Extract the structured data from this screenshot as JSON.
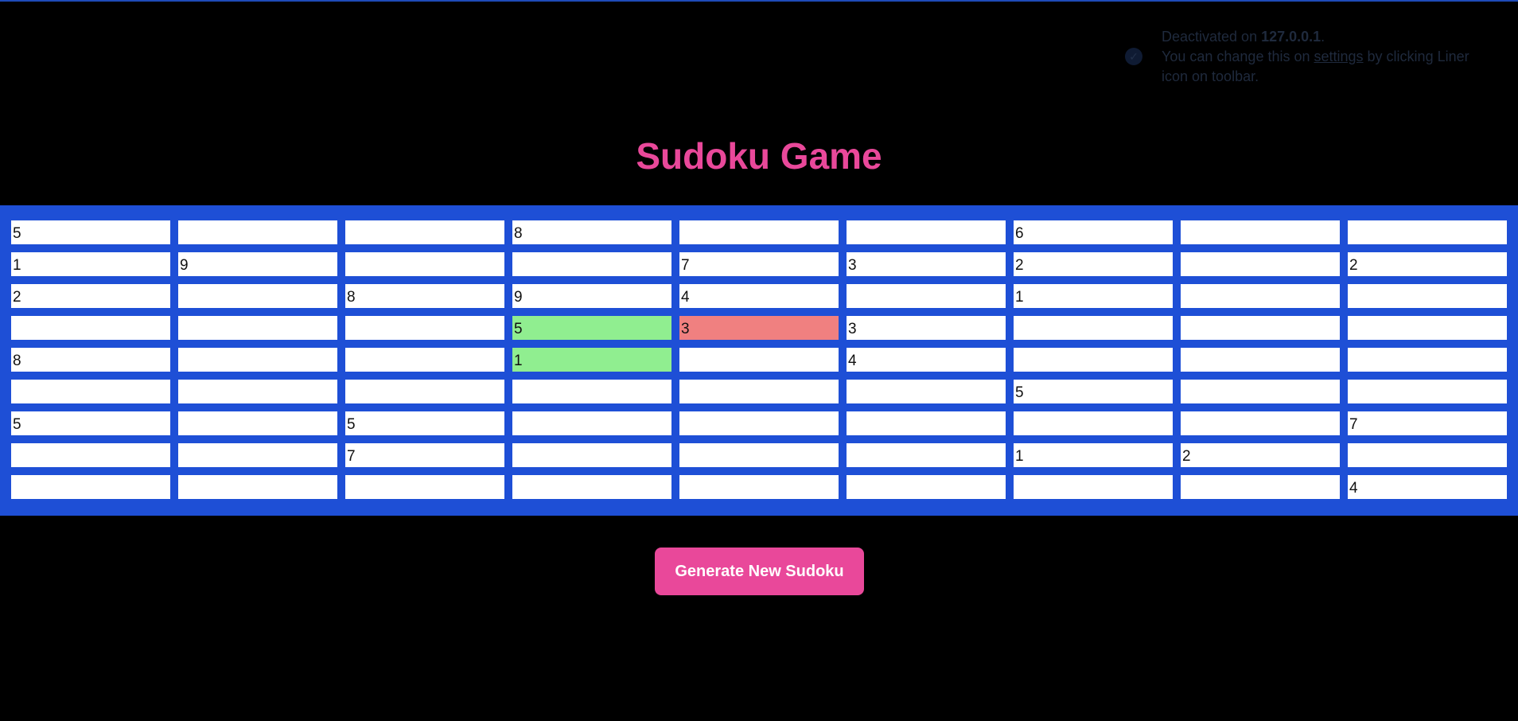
{
  "notice": {
    "line1_prefix": "Deactivated on ",
    "host": "127.0.0.1",
    "line1_suffix": ".",
    "line2_prefix": "You can change this on ",
    "settings_link": "settings",
    "line2_suffix": " by clicking Liner icon on toolbar."
  },
  "title": "Sudoku Game",
  "colors": {
    "background": "#000000",
    "title": "#e9489a",
    "board": "#1e4fd6",
    "cell": "#ffffff",
    "cell_valid": "#90ee90",
    "cell_conflict": "#f08080",
    "button": "#e9489a"
  },
  "grid": [
    [
      {
        "v": "5"
      },
      {
        "v": ""
      },
      {
        "v": ""
      },
      {
        "v": "8"
      },
      {
        "v": ""
      },
      {
        "v": ""
      },
      {
        "v": "6"
      },
      {
        "v": ""
      },
      {
        "v": ""
      }
    ],
    [
      {
        "v": "1"
      },
      {
        "v": "9"
      },
      {
        "v": ""
      },
      {
        "v": ""
      },
      {
        "v": "7"
      },
      {
        "v": "3"
      },
      {
        "v": "2"
      },
      {
        "v": ""
      },
      {
        "v": "2"
      }
    ],
    [
      {
        "v": "2"
      },
      {
        "v": ""
      },
      {
        "v": "8"
      },
      {
        "v": "9"
      },
      {
        "v": "4"
      },
      {
        "v": ""
      },
      {
        "v": "1"
      },
      {
        "v": ""
      },
      {
        "v": ""
      }
    ],
    [
      {
        "v": ""
      },
      {
        "v": ""
      },
      {
        "v": ""
      },
      {
        "v": "5",
        "state": "valid"
      },
      {
        "v": "3",
        "state": "conflict"
      },
      {
        "v": "3"
      },
      {
        "v": ""
      },
      {
        "v": ""
      },
      {
        "v": ""
      }
    ],
    [
      {
        "v": "8"
      },
      {
        "v": ""
      },
      {
        "v": ""
      },
      {
        "v": "1",
        "state": "valid"
      },
      {
        "v": ""
      },
      {
        "v": "4"
      },
      {
        "v": ""
      },
      {
        "v": ""
      },
      {
        "v": ""
      }
    ],
    [
      {
        "v": ""
      },
      {
        "v": ""
      },
      {
        "v": ""
      },
      {
        "v": ""
      },
      {
        "v": ""
      },
      {
        "v": ""
      },
      {
        "v": "5"
      },
      {
        "v": ""
      },
      {
        "v": ""
      }
    ],
    [
      {
        "v": "5"
      },
      {
        "v": ""
      },
      {
        "v": "5"
      },
      {
        "v": ""
      },
      {
        "v": ""
      },
      {
        "v": ""
      },
      {
        "v": ""
      },
      {
        "v": ""
      },
      {
        "v": "7"
      }
    ],
    [
      {
        "v": ""
      },
      {
        "v": ""
      },
      {
        "v": "7"
      },
      {
        "v": ""
      },
      {
        "v": ""
      },
      {
        "v": ""
      },
      {
        "v": "1"
      },
      {
        "v": "2"
      },
      {
        "v": ""
      }
    ],
    [
      {
        "v": ""
      },
      {
        "v": ""
      },
      {
        "v": ""
      },
      {
        "v": ""
      },
      {
        "v": ""
      },
      {
        "v": ""
      },
      {
        "v": ""
      },
      {
        "v": ""
      },
      {
        "v": "4"
      }
    ]
  ],
  "generate_button_label": "Generate New Sudoku"
}
